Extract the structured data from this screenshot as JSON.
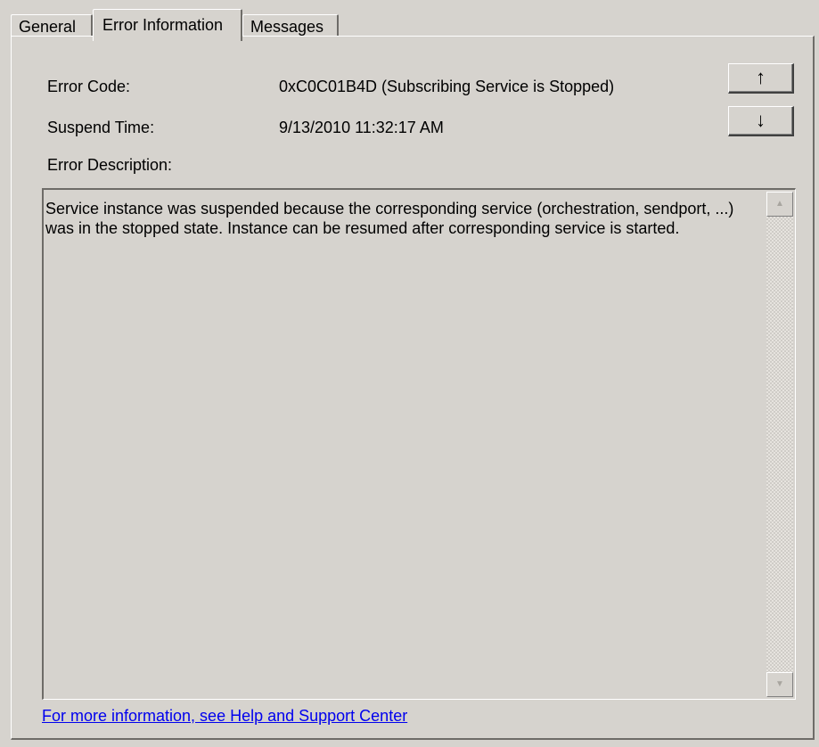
{
  "tabs": [
    {
      "label": "General"
    },
    {
      "label": "Error Information"
    },
    {
      "label": "Messages"
    }
  ],
  "active_tab": "Error Information",
  "fields": {
    "error_code_label": "Error Code:",
    "error_code_value": "0xC0C01B4D (Subscribing Service is Stopped)",
    "suspend_time_label": "Suspend Time:",
    "suspend_time_value": "9/13/2010 11:32:17 AM",
    "error_description_label": "Error Description:"
  },
  "buttons": {
    "up_label": "↑",
    "down_label": "↓"
  },
  "description": {
    "text": "Service instance was suspended because the corresponding service (orchestration, sendport, ...) was in the stopped state. Instance can be resumed after corresponding service is started."
  },
  "scrollbar": {
    "up_glyph": "▲",
    "down_glyph": "▼"
  },
  "help_link": {
    "text": "For more information, see Help and Support Center"
  },
  "colors": {
    "background": "#d6d3ce",
    "link": "#0000ee"
  }
}
